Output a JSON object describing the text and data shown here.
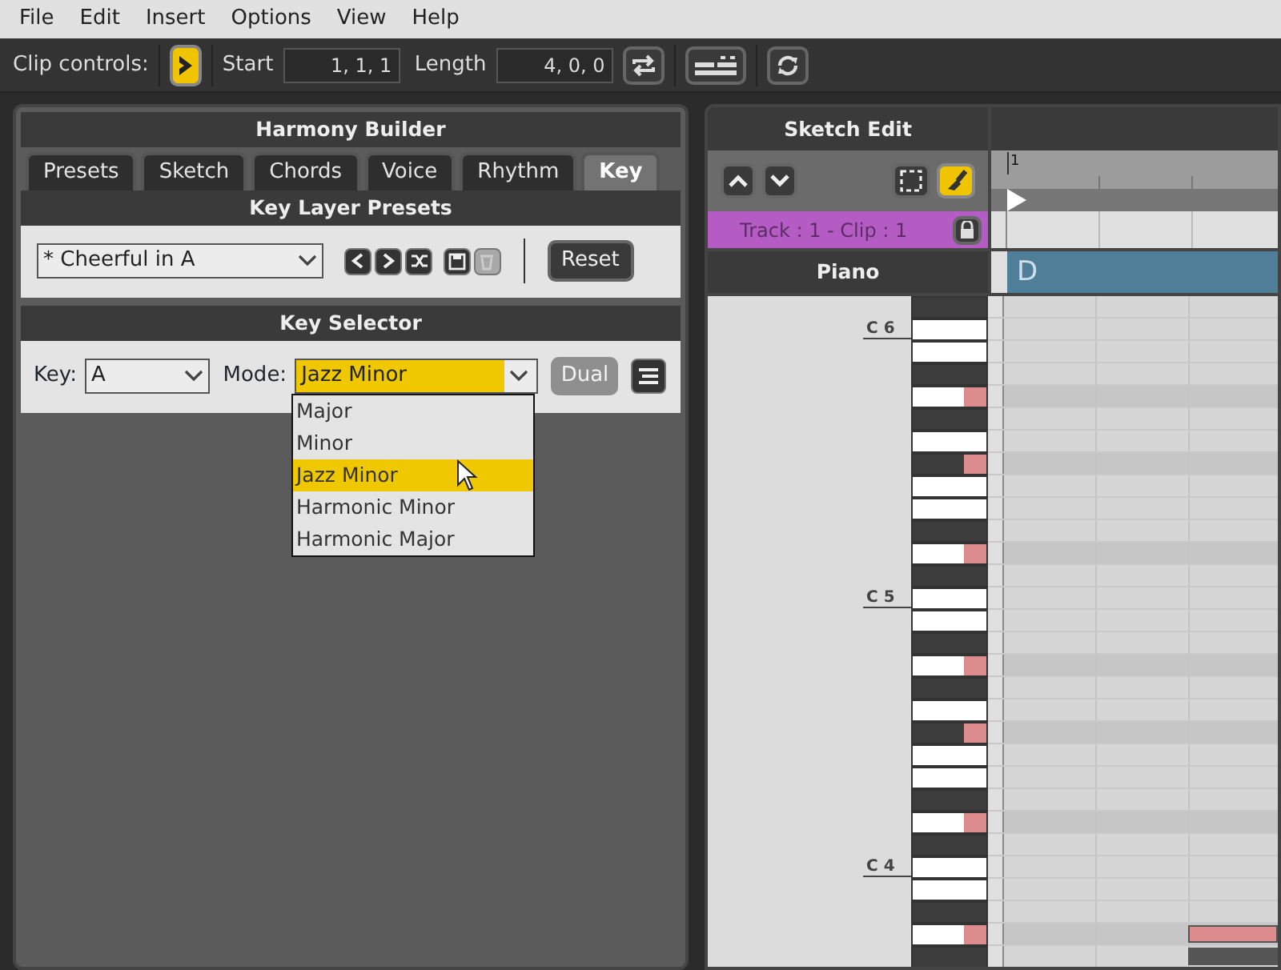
{
  "menu": [
    "File",
    "Edit",
    "Insert",
    "Options",
    "View",
    "Help"
  ],
  "toolbar": {
    "label": "Clip controls:",
    "follow_on": true,
    "start_label": "Start",
    "start": "1, 1, 1",
    "length_label": "Length",
    "length": "4, 0, 0"
  },
  "harmony_builder": {
    "title": "Harmony Builder",
    "tabs": [
      {
        "label": "Presets",
        "selected": false
      },
      {
        "label": "Sketch",
        "selected": false
      },
      {
        "label": "Chords",
        "selected": false
      },
      {
        "label": "Voice",
        "selected": false
      },
      {
        "label": "Rhythm",
        "selected": false
      },
      {
        "label": "Key",
        "selected": true
      }
    ],
    "presets": {
      "title": "Key Layer Presets",
      "preset": "* Cheerful in A",
      "delete_disabled": true,
      "reset": "Reset"
    },
    "key_selector": {
      "title": "Key Selector",
      "key_label": "Key:",
      "key": "A",
      "mode_label": "Mode:",
      "mode": "Jazz Minor",
      "dual": "Dual",
      "dual_disabled": true,
      "mode_options": [
        {
          "label": "Major",
          "selected": false
        },
        {
          "label": "Minor",
          "selected": false
        },
        {
          "label": "Jazz Minor",
          "selected": true
        },
        {
          "label": "Harmonic Minor",
          "selected": false
        },
        {
          "label": "Harmonic Major",
          "selected": false
        }
      ]
    }
  },
  "sketch_edit": {
    "title": "Sketch Edit",
    "brush_on": true,
    "track": "Track : 1 - Clip : 1",
    "instrument": "Piano",
    "ruler_mark": "1",
    "chord": "D",
    "keys": [
      {
        "kind": "black",
        "highlighted": false
      },
      {
        "kind": "white",
        "highlighted": false,
        "label": "C 6"
      },
      {
        "kind": "white",
        "highlighted": false
      },
      {
        "kind": "black",
        "highlighted": false
      },
      {
        "kind": "white",
        "highlighted": true
      },
      {
        "kind": "black",
        "highlighted": false
      },
      {
        "kind": "white",
        "highlighted": false
      },
      {
        "kind": "black",
        "highlighted": true
      },
      {
        "kind": "white",
        "highlighted": false
      },
      {
        "kind": "white",
        "highlighted": false
      },
      {
        "kind": "black",
        "highlighted": false
      },
      {
        "kind": "white",
        "highlighted": true
      },
      {
        "kind": "black",
        "highlighted": false
      },
      {
        "kind": "white",
        "highlighted": false,
        "label": "C 5"
      },
      {
        "kind": "white",
        "highlighted": false
      },
      {
        "kind": "black",
        "highlighted": false
      },
      {
        "kind": "white",
        "highlighted": true
      },
      {
        "kind": "black",
        "highlighted": false
      },
      {
        "kind": "white",
        "highlighted": false
      },
      {
        "kind": "black",
        "highlighted": true
      },
      {
        "kind": "white",
        "highlighted": false
      },
      {
        "kind": "white",
        "highlighted": false
      },
      {
        "kind": "black",
        "highlighted": false
      },
      {
        "kind": "white",
        "highlighted": true
      },
      {
        "kind": "black",
        "highlighted": false
      },
      {
        "kind": "white",
        "highlighted": false,
        "label": "C 4"
      },
      {
        "kind": "white",
        "highlighted": false
      },
      {
        "kind": "black",
        "highlighted": false
      },
      {
        "kind": "white",
        "highlighted": true,
        "note": {
          "color": "#dc8c8c"
        }
      },
      {
        "kind": "black",
        "highlighted": false,
        "note": {
          "color": "#555555"
        }
      }
    ]
  }
}
